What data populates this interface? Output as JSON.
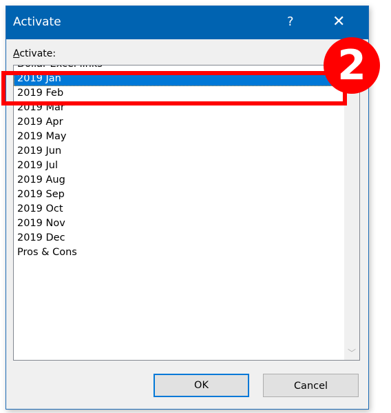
{
  "dialog": {
    "title": "Activate",
    "help_label": "?",
    "close_label": "✕",
    "field_label_accel": "A",
    "field_label_rest": "ctivate:",
    "items": [
      {
        "label": "Dollar Excel links"
      },
      {
        "label": "2019 Jan"
      },
      {
        "label": "2019 Feb"
      },
      {
        "label": "2019 Mar"
      },
      {
        "label": "2019 Apr"
      },
      {
        "label": "2019 May"
      },
      {
        "label": "2019 Jun"
      },
      {
        "label": "2019 Jul"
      },
      {
        "label": "2019 Aug"
      },
      {
        "label": "2019 Sep"
      },
      {
        "label": "2019 Oct"
      },
      {
        "label": "2019 Nov"
      },
      {
        "label": "2019 Dec"
      },
      {
        "label": "Pros & Cons"
      }
    ],
    "selected_index": 1,
    "scroll_down_label": "﹀",
    "ok_label": "OK",
    "cancel_label": "Cancel"
  },
  "annotation": {
    "step_number": "2",
    "color": "#ff0000"
  }
}
